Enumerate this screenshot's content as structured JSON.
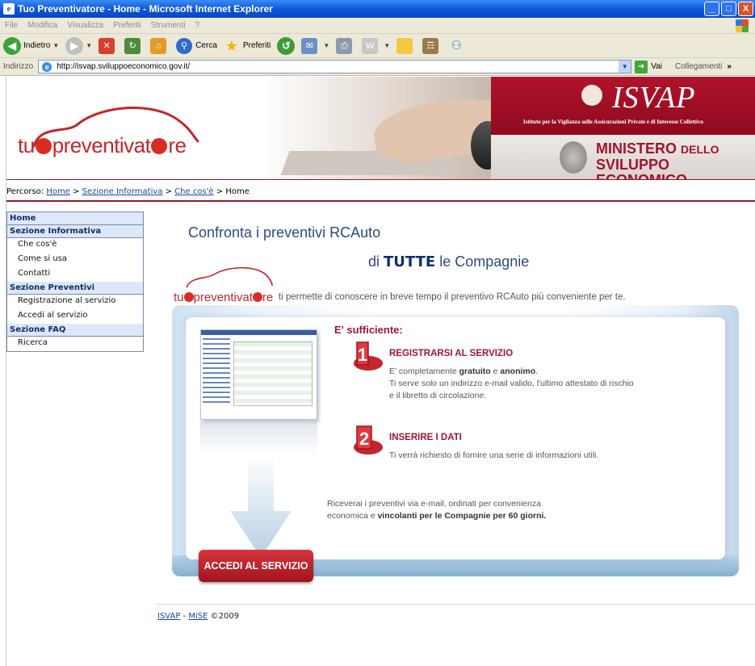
{
  "window": {
    "title": "Tuo Preventivatore - Home - Microsoft Internet Explorer",
    "controls": [
      "_",
      "□",
      "X"
    ]
  },
  "menu": [
    "File",
    "Modifica",
    "Visualizza",
    "Preferiti",
    "Strumenti",
    "?"
  ],
  "toolbar": {
    "back": "Indietro",
    "search": "Cerca",
    "favorites": "Preferiti"
  },
  "address": {
    "label": "Indirizzo",
    "url": "http://isvap.sviluppoeconomico.gov.it/",
    "go": "Vai",
    "links": "Collegamenti"
  },
  "banner": {
    "logo_pre": "tu",
    "logo_mid": "preventivat",
    "logo_post": "re",
    "isvap": "ISVAP",
    "isvap_sub": "Istituto per la Vigilanza sulle Assicurazioni Private e di Interesse Collettivo",
    "mise_line1": "MINISTERO",
    "mise_line1b": "DELLO",
    "mise_line2": "SVILUPPO ECONOMICO"
  },
  "breadcrumb": {
    "label": "Percorso:",
    "items": [
      "Home",
      "Sezione Informativa",
      "Che cos'è"
    ],
    "current": "Home"
  },
  "sidebar": {
    "home": "Home",
    "info_header": "Sezione Informativa",
    "info_items": [
      "Che cos'è",
      "Come si usa",
      "Contatti"
    ],
    "prev_header": "Sezione Preventivi",
    "prev_items": [
      "Registrazione al servizio",
      "Accedi al servizio"
    ],
    "faq_header": "Sezione FAQ",
    "faq_items": [
      "Ricerca"
    ]
  },
  "main": {
    "headline1": "Confronta i preventivi RCAuto",
    "headline2_pre": "di",
    "headline2_bold": "TUTTE",
    "headline2_post": "le Compagnie",
    "intro_text": "ti permette di conoscere in breve tempo il preventivo RCAuto più conveniente per te.",
    "sufficient": "E' sufficiente:",
    "step1": {
      "number": "1",
      "title": "REGISTRARSI AL SERVIZIO",
      "line1_pre": "E' completamente",
      "line1_b1": "gratuito",
      "line1_mid": "e",
      "line1_b2": "anonimo",
      "line1_end": ".",
      "line2": "Ti serve solo un indirizzo e-mail valido, l'ultimo attestato di rischio",
      "line3": "e il libretto di circolazione."
    },
    "step2": {
      "number": "2",
      "title": "INSERIRE I DATI",
      "line1": "Ti verrà richiesto di fornire una serie di informazioni utili."
    },
    "final_line1": "Riceverai i preventivi via e-mail, ordinati per convenienza",
    "final_line2_pre": "economica e",
    "final_line2_bold": "vincolanti per le Compagnie per 60 giorni.",
    "cta": "ACCEDI AL SERVIZIO"
  },
  "footer": {
    "isvap": "ISVAP",
    "sep": " - ",
    "mise": "MiSE",
    "copy": "©2009"
  }
}
